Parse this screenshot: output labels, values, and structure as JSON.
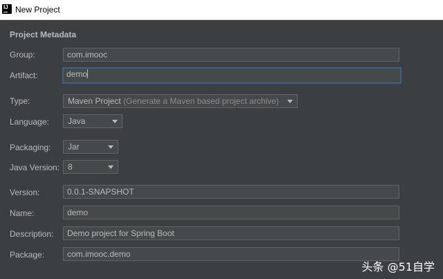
{
  "window": {
    "title": "New Project",
    "app_icon": "intellij-idea-icon"
  },
  "section": {
    "title": "Project Metadata"
  },
  "fields": {
    "group": {
      "label": "Group:",
      "value": "com.imooc"
    },
    "artifact": {
      "label": "Artifact:",
      "value": "demo"
    },
    "type": {
      "label": "Type:",
      "value": "Maven Project",
      "hint": "(Generate a Maven based project archive)"
    },
    "language": {
      "label": "Language:",
      "value": "Java"
    },
    "packaging": {
      "label": "Packaging:",
      "value": "Jar"
    },
    "java_version": {
      "label": "Java Version:",
      "value": "8"
    },
    "version": {
      "label": "Version:",
      "value": "0.0.1-SNAPSHOT"
    },
    "name": {
      "label": "Name:",
      "value": "demo"
    },
    "description": {
      "label": "Description:",
      "value": "Demo project for Spring Boot"
    },
    "package": {
      "label": "Package:",
      "value": "com.imooc.demo"
    }
  },
  "watermark": {
    "text": "头条 @51自学"
  },
  "colors": {
    "background": "#3c3f41",
    "field_bg": "#45494a",
    "focus": "#3d6185",
    "text": "#bbbbbb"
  }
}
